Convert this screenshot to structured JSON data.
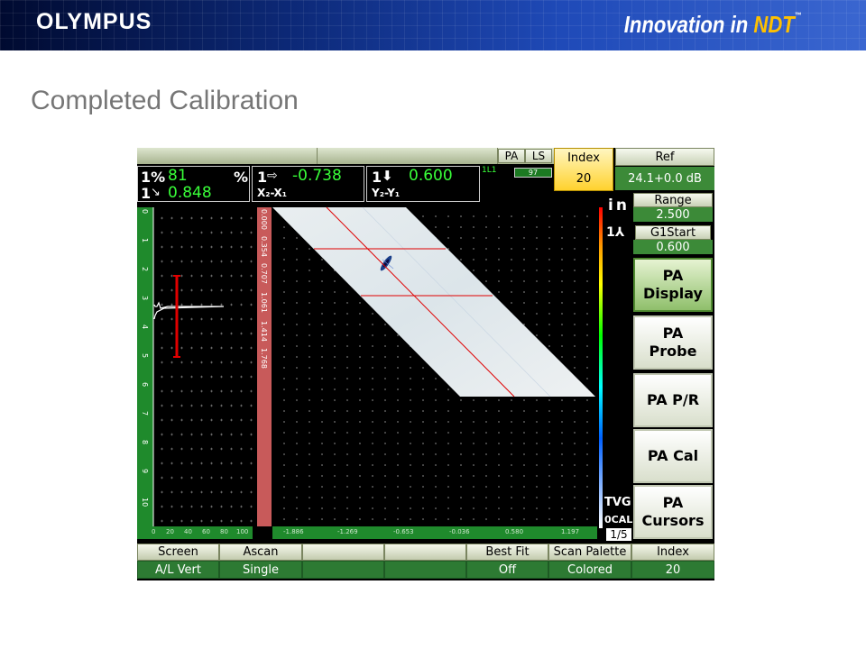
{
  "slide": {
    "logo": "OLYMPUS",
    "tagline_prefix": "Innovation in ",
    "tagline_ndt": "NDT",
    "tagline_tm": "™",
    "title": "Completed Calibration"
  },
  "screen": {
    "top_tabs": {
      "pa": "PA",
      "ls": "LS"
    },
    "index": {
      "label": "Index",
      "value": "20"
    },
    "ref": {
      "label": "Ref",
      "value": "24.1+0.0  dB"
    },
    "status_label": "1L1",
    "battery_value": "97",
    "readings": {
      "box1": {
        "row1_label": "1%",
        "row1_value": "81",
        "row1_unit": "%",
        "row2_label": "1",
        "row2_value": "0.848"
      },
      "box2": {
        "row1_label": "1",
        "row1_value": "-0.738",
        "row2_label": "X₂-X₁"
      },
      "box3": {
        "row1_label": "1",
        "row1_value": "0.600",
        "row2_label": "Y₂-Y₁"
      }
    },
    "range": {
      "label": "Range",
      "value": "2.500"
    },
    "g1start": {
      "label": "G1Start",
      "value": "0.600"
    },
    "unit_label": "in",
    "menu": [
      {
        "line1": "PA",
        "line2": "Display",
        "active": true
      },
      {
        "line1": "PA",
        "line2": "Probe",
        "active": false
      },
      {
        "line1": "PA P/R",
        "line2": "",
        "active": false
      },
      {
        "line1": "PA Cal",
        "line2": "",
        "active": false
      },
      {
        "line1": "PA",
        "line2": "Cursors",
        "active": false
      }
    ],
    "tvg_label": "TVG",
    "cal_label": "0CAL",
    "page_indicator": "1/5",
    "ascan_depth_ticks": [
      "0",
      "1",
      "2",
      "3",
      "4",
      "5",
      "6",
      "7",
      "8",
      "9",
      "10"
    ],
    "ascan_amp_ticks": [
      "0",
      "20",
      "40",
      "60",
      "80",
      "100"
    ],
    "sscan_depth_ruler": [
      "0.000",
      "0.354",
      "0.707",
      "1.061",
      "1.414",
      "1.768"
    ],
    "sscan_x_ticks": [
      "-1.886",
      "-1.269",
      "-0.653",
      "-0.036",
      "0.580",
      "1.197"
    ],
    "bottom_bar": [
      {
        "label": "Screen",
        "value": "A/L Vert"
      },
      {
        "label": "Ascan",
        "value": "Single"
      },
      {
        "label": "",
        "value": ""
      },
      {
        "label": "",
        "value": ""
      },
      {
        "label": "Best Fit",
        "value": "Off"
      },
      {
        "label": "Scan Palette",
        "value": "Colored"
      },
      {
        "label": "Index",
        "value": "20"
      }
    ],
    "colors": {
      "accent_green": "#39ff39",
      "cursor_red": "#e00000",
      "menu_active": "#8fbf6b",
      "value_green": "#2d7a33"
    }
  }
}
